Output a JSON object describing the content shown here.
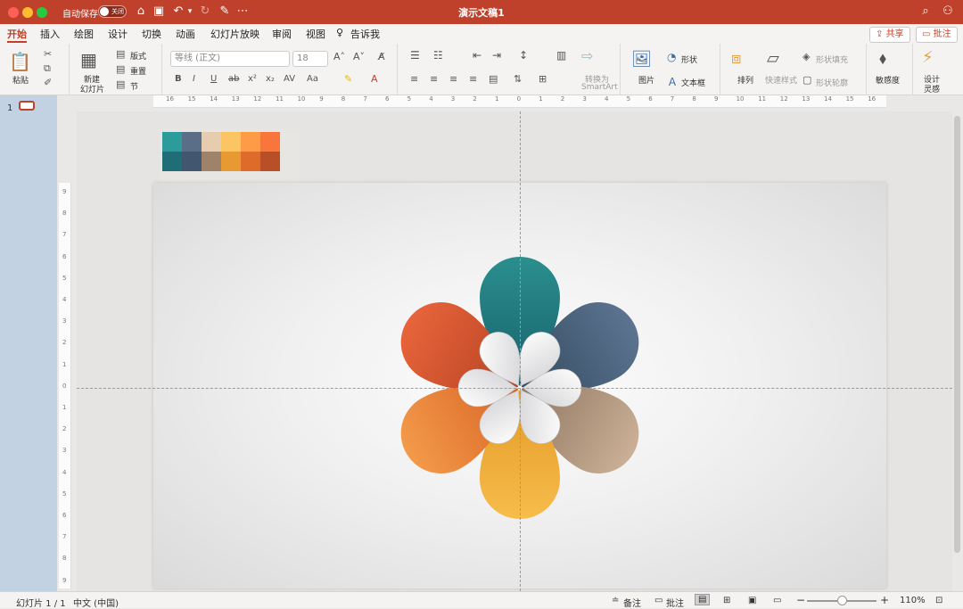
{
  "window": {
    "title": "演示文稿1",
    "autosave_label": "自动保存",
    "autosave_state": "关闭"
  },
  "tabs": [
    "开始",
    "插入",
    "绘图",
    "设计",
    "切换",
    "动画",
    "幻灯片放映",
    "审阅",
    "视图",
    "告诉我"
  ],
  "share_label": "共享",
  "comment_label": "批注",
  "ribbon": {
    "paste": "粘贴",
    "new_slide_1": "新建",
    "new_slide_2": "幻灯片",
    "layout": "版式",
    "reset": "重置",
    "section": "节",
    "font_name": "等线 (正文)",
    "font_size": "18",
    "convert_smartart_1": "转换为",
    "convert_smartart_2": "SmartArt",
    "picture": "图片",
    "shapes": "形状",
    "textbox": "文本框",
    "arrange": "排列",
    "quick_styles": "快速样式",
    "shape_fill": "形状填充",
    "shape_outline": "形状轮廓",
    "sensitivity": "敏感度",
    "designer_1": "设计",
    "designer_2": "灵感"
  },
  "ruler": {
    "h_ticks": [
      "16",
      "15",
      "14",
      "13",
      "12",
      "11",
      "10",
      "9",
      "8",
      "7",
      "6",
      "5",
      "4",
      "3",
      "2",
      "1",
      "0",
      "1",
      "2",
      "3",
      "4",
      "5",
      "6",
      "7",
      "8",
      "9",
      "10",
      "11",
      "12",
      "13",
      "14",
      "15",
      "16"
    ],
    "v_ticks": [
      "9",
      "8",
      "7",
      "6",
      "5",
      "4",
      "3",
      "2",
      "1",
      "0",
      "1",
      "2",
      "3",
      "4",
      "5",
      "6",
      "7",
      "8",
      "9"
    ]
  },
  "thumbnail_number": "1",
  "palette": {
    "row1": [
      "#2b9b9b",
      "#5a6e88",
      "#e7cdb0",
      "#fcc563",
      "#fd9b47",
      "#f8753b"
    ],
    "row2": [
      "#1f6e77",
      "#43566f",
      "#9e8269",
      "#e79a31",
      "#de6b2a",
      "#b84f26"
    ]
  },
  "petals": [
    {
      "name": "top",
      "angle": 0,
      "c1": "#2b8f8e",
      "c2": "#17606a"
    },
    {
      "name": "upper-right",
      "angle": 60,
      "c1": "#5d7491",
      "c2": "#334a5f"
    },
    {
      "name": "lower-right",
      "angle": 120,
      "c1": "#cbb097",
      "c2": "#8f7560"
    },
    {
      "name": "bottom",
      "angle": 180,
      "c1": "#f7bc4a",
      "c2": "#e39a27"
    },
    {
      "name": "lower-left",
      "angle": 240,
      "c1": "#f39a4a",
      "c2": "#d96425"
    },
    {
      "name": "upper-left",
      "angle": 300,
      "c1": "#e8643b",
      "c2": "#b54322"
    }
  ],
  "status": {
    "slide_counter": "幻灯片 1 / 1",
    "language": "中文 (中国)",
    "notes": "备注",
    "comments": "批注",
    "zoom": "110%"
  }
}
